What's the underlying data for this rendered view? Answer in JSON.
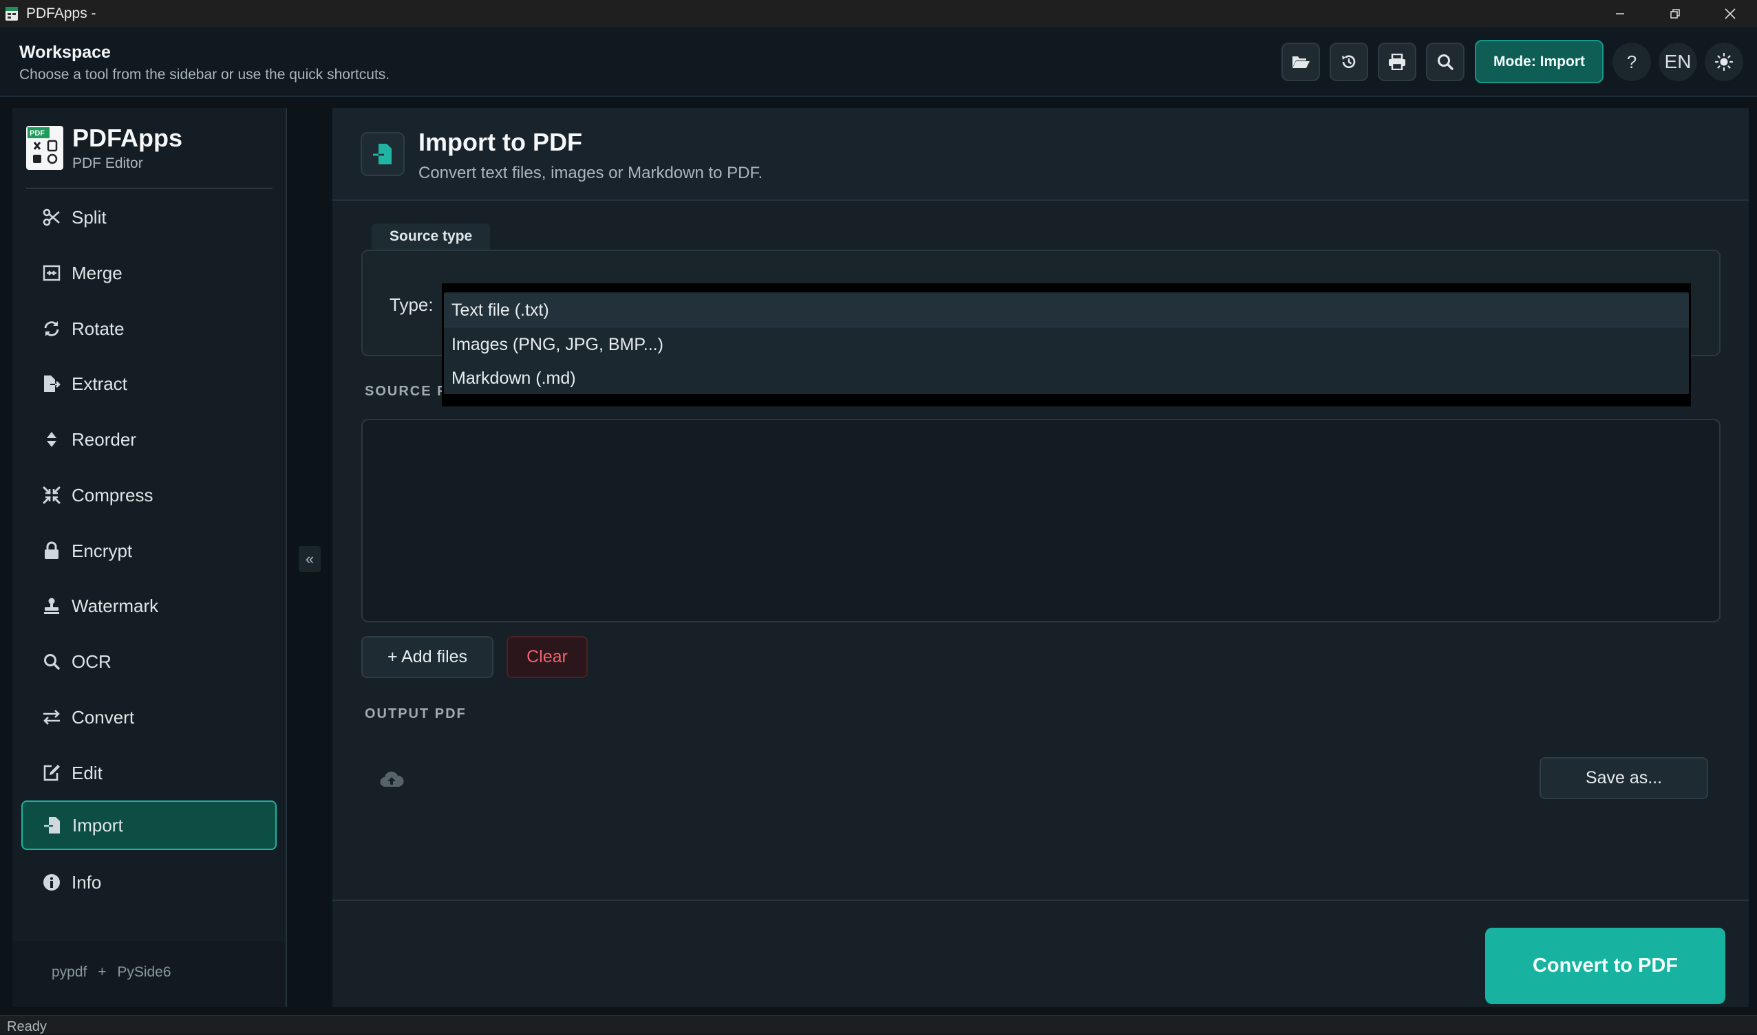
{
  "window": {
    "title": "PDFApps -",
    "controls": [
      "minimize-icon",
      "restore-icon",
      "close-icon"
    ]
  },
  "header": {
    "title": "Workspace",
    "subtitle": "Choose a tool from the sidebar or use the quick shortcuts.",
    "toolbar_icons": [
      "folder-open-icon",
      "history-icon",
      "print-icon",
      "search-icon"
    ],
    "mode_label": "Mode: Import",
    "help_label": "?",
    "language_label": "EN",
    "theme_icon": "sun-icon"
  },
  "sidebar": {
    "brand": "PDFApps",
    "brand_sub": "PDF Editor",
    "items": [
      {
        "label": "Split",
        "icon": "scissors-icon"
      },
      {
        "label": "Merge",
        "icon": "merge-icon"
      },
      {
        "label": "Rotate",
        "icon": "rotate-icon"
      },
      {
        "label": "Extract",
        "icon": "file-export-icon"
      },
      {
        "label": "Reorder",
        "icon": "sort-icon"
      },
      {
        "label": "Compress",
        "icon": "compress-icon"
      },
      {
        "label": "Encrypt",
        "icon": "lock-icon"
      },
      {
        "label": "Watermark",
        "icon": "stamp-icon"
      },
      {
        "label": "OCR",
        "icon": "search-icon"
      },
      {
        "label": "Convert",
        "icon": "exchange-icon"
      },
      {
        "label": "Edit",
        "icon": "edit-icon"
      },
      {
        "label": "Import",
        "icon": "file-import-icon",
        "active": true
      },
      {
        "label": "Info",
        "icon": "info-icon"
      }
    ],
    "footer_left": "pypdf",
    "footer_sep": "+",
    "footer_right": "PySide6",
    "collapse_label": "«"
  },
  "main": {
    "title": "Import to PDF",
    "subtitle": "Convert text files, images or Markdown to PDF.",
    "source_type_tab": "Source type",
    "type_label": "Type:",
    "type_options": [
      "Text file (.txt)",
      "Images (PNG, JPG, BMP...)",
      "Markdown (.md)"
    ],
    "source_files_label": "SOURCE F",
    "add_files_label": "+  Add files",
    "clear_label": "Clear",
    "output_label": "OUTPUT PDF",
    "save_as_label": "Save as...",
    "convert_label": "Convert to PDF"
  },
  "status": {
    "text": "Ready"
  },
  "colors": {
    "accent": "#17b2a0",
    "active_nav_bg": "#0c4d44",
    "danger": "#f0646f",
    "background": "#0d1419"
  }
}
